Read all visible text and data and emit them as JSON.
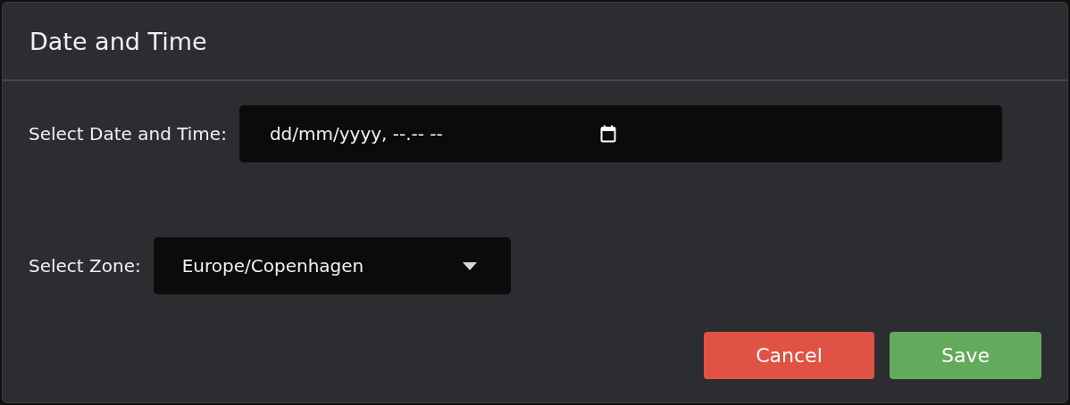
{
  "dialog": {
    "title": "Date and Time"
  },
  "date_time": {
    "label": "Select Date and Time:",
    "placeholder": "dd/mm/yyyy, --.-- --"
  },
  "zone": {
    "label": "Select Zone:",
    "value": "Europe/Copenhagen"
  },
  "buttons": [
    {
      "label": "Cancel",
      "kind": "cancel"
    },
    {
      "label": "Save",
      "kind": "save"
    }
  ]
}
